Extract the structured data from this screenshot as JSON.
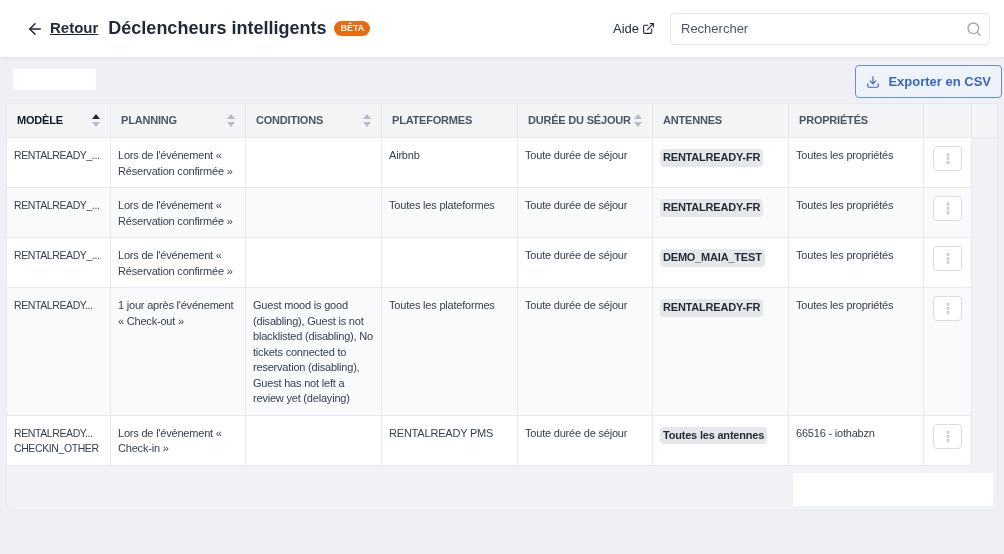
{
  "header": {
    "back_label": "Retour",
    "title": "Déclencheurs intelligents",
    "badge": "BÊTA",
    "help_label": "Aide",
    "search": {
      "placeholder": "Rechercher"
    }
  },
  "toolbar": {
    "export_label": "Exporter en CSV"
  },
  "table": {
    "columns": [
      {
        "label": "MODÈLE",
        "sorted": true
      },
      {
        "label": "PLANNING",
        "sorted": false
      },
      {
        "label": "CONDITIONS",
        "sorted": false
      },
      {
        "label": "PLATEFORMES"
      },
      {
        "label": "DURÉE DU SÉJOUR",
        "sorted": false
      },
      {
        "label": "ANTENNES"
      },
      {
        "label": "PROPRIÉTÉS"
      }
    ],
    "rows": [
      {
        "model": "RENTALREADY_...",
        "planning": "Lors de l'événement « Réservation confirmée »",
        "conditions": "",
        "platforms": "Airbnb",
        "duration": "Toute durée de séjour",
        "antenna": "RENTALREADY-FR",
        "properties": "Toutes les propriétés"
      },
      {
        "model": "RENTALREADY_...",
        "planning": "Lors de l'événement « Réservation confirmée »",
        "conditions": "",
        "platforms": "Toutes les plateformes",
        "duration": "Toute durée de séjour",
        "antenna": "RENTALREADY-FR",
        "properties": "Toutes les propriétés"
      },
      {
        "model": "RENTALREADY_...",
        "planning": "Lors de l'événement « Réservation confirmée »",
        "conditions": "",
        "platforms": "",
        "duration": "Toute durée de séjour",
        "antenna": "DEMO_MAIA_TEST",
        "properties": "Toutes les propriétés"
      },
      {
        "model": "RENTALREADY...",
        "planning": "1 jour après l'événement « Check-out »",
        "conditions": "Guest mood is good (disabling), Guest is not blacklisted (disabling), No tickets connected to reservation (disabling), Guest has not left a review yet (delaying)",
        "platforms": "Toutes les plateformes",
        "duration": "Toute durée de séjour",
        "antenna": "RENTALREADY-FR",
        "properties": "Toutes les propriétés"
      },
      {
        "model": "RENTALREADY... CHECKIN_OTHER",
        "planning": "Lors de l'événement « Check-in »",
        "conditions": "",
        "platforms": "RENTALREADY PMS",
        "duration": "Toute durée de séjour",
        "antenna": "Toutes les antennes",
        "properties": "66516 - iothabzn"
      }
    ]
  }
}
